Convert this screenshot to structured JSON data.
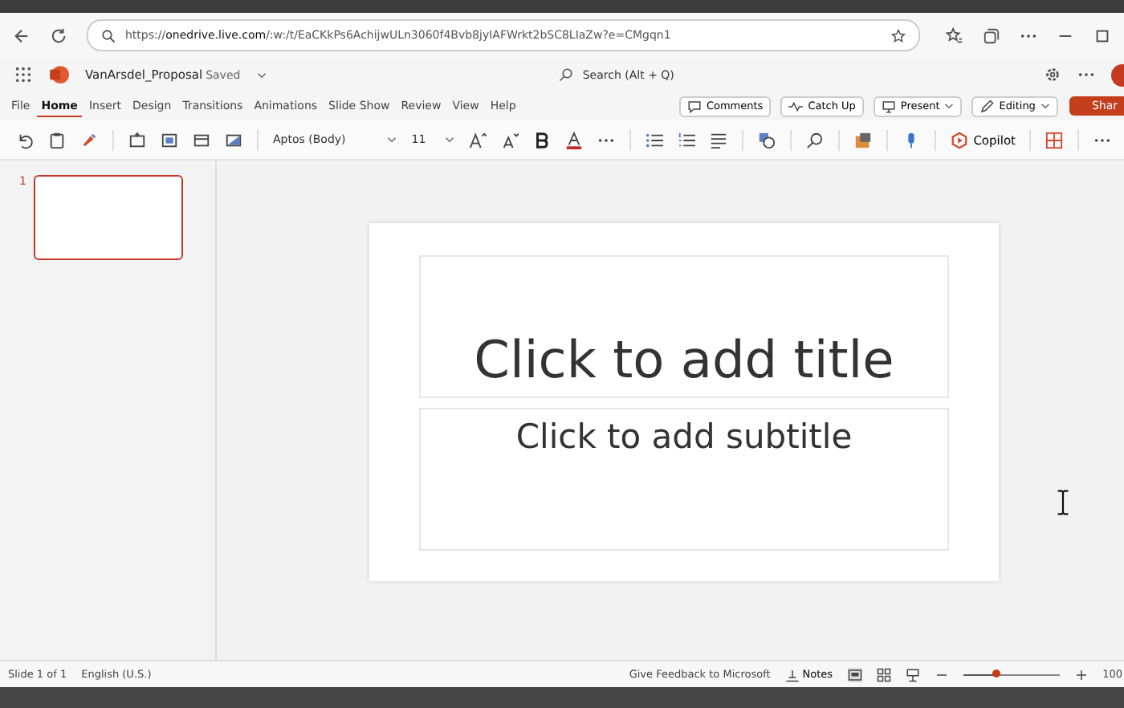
{
  "browser": {
    "url_prefix": "https://",
    "url_host": "onedrive.live.com",
    "url_rest": "/:w:/t/EaCKkPs6AchijwULn3060f4Bvb8jyIAFWrkt2bSC8LIaZw?e=CMgqn1"
  },
  "app": {
    "file_name": "VanArsdel_Proposal",
    "save_state": "Saved",
    "search_placeholder": "Search (Alt + Q)"
  },
  "ribbon_tabs": [
    {
      "label": "File",
      "selected": false
    },
    {
      "label": "Home",
      "selected": true
    },
    {
      "label": "Insert",
      "selected": false
    },
    {
      "label": "Design",
      "selected": false
    },
    {
      "label": "Transitions",
      "selected": false
    },
    {
      "label": "Animations",
      "selected": false
    },
    {
      "label": "Slide Show",
      "selected": false
    },
    {
      "label": "Review",
      "selected": false
    },
    {
      "label": "View",
      "selected": false
    },
    {
      "label": "Help",
      "selected": false
    }
  ],
  "header_buttons": [
    {
      "label": "Comments",
      "kind": "comment"
    },
    {
      "label": "Catch Up",
      "kind": "pulse"
    },
    {
      "label": "Present",
      "kind": "present"
    },
    {
      "label": "Editing",
      "kind": "pen"
    }
  ],
  "share_button": "Shar",
  "toolbar": {
    "font_name": "Aptos (Body)",
    "font_size": "11",
    "copilot": "Copilot"
  },
  "thumbnails": [
    {
      "number": "1",
      "selected": true
    }
  ],
  "slide": {
    "title_placeholder": "Click to add title",
    "subtitle_placeholder": "Click to add subtitle"
  },
  "status_bar": {
    "slide_count": "Slide 1 of 1",
    "language": "English (U.S.)",
    "feedback": "Give Feedback to Microsoft",
    "notes": "Notes",
    "zoom_slider": {
      "level": 0.35
    },
    "zoom_text": "100"
  }
}
